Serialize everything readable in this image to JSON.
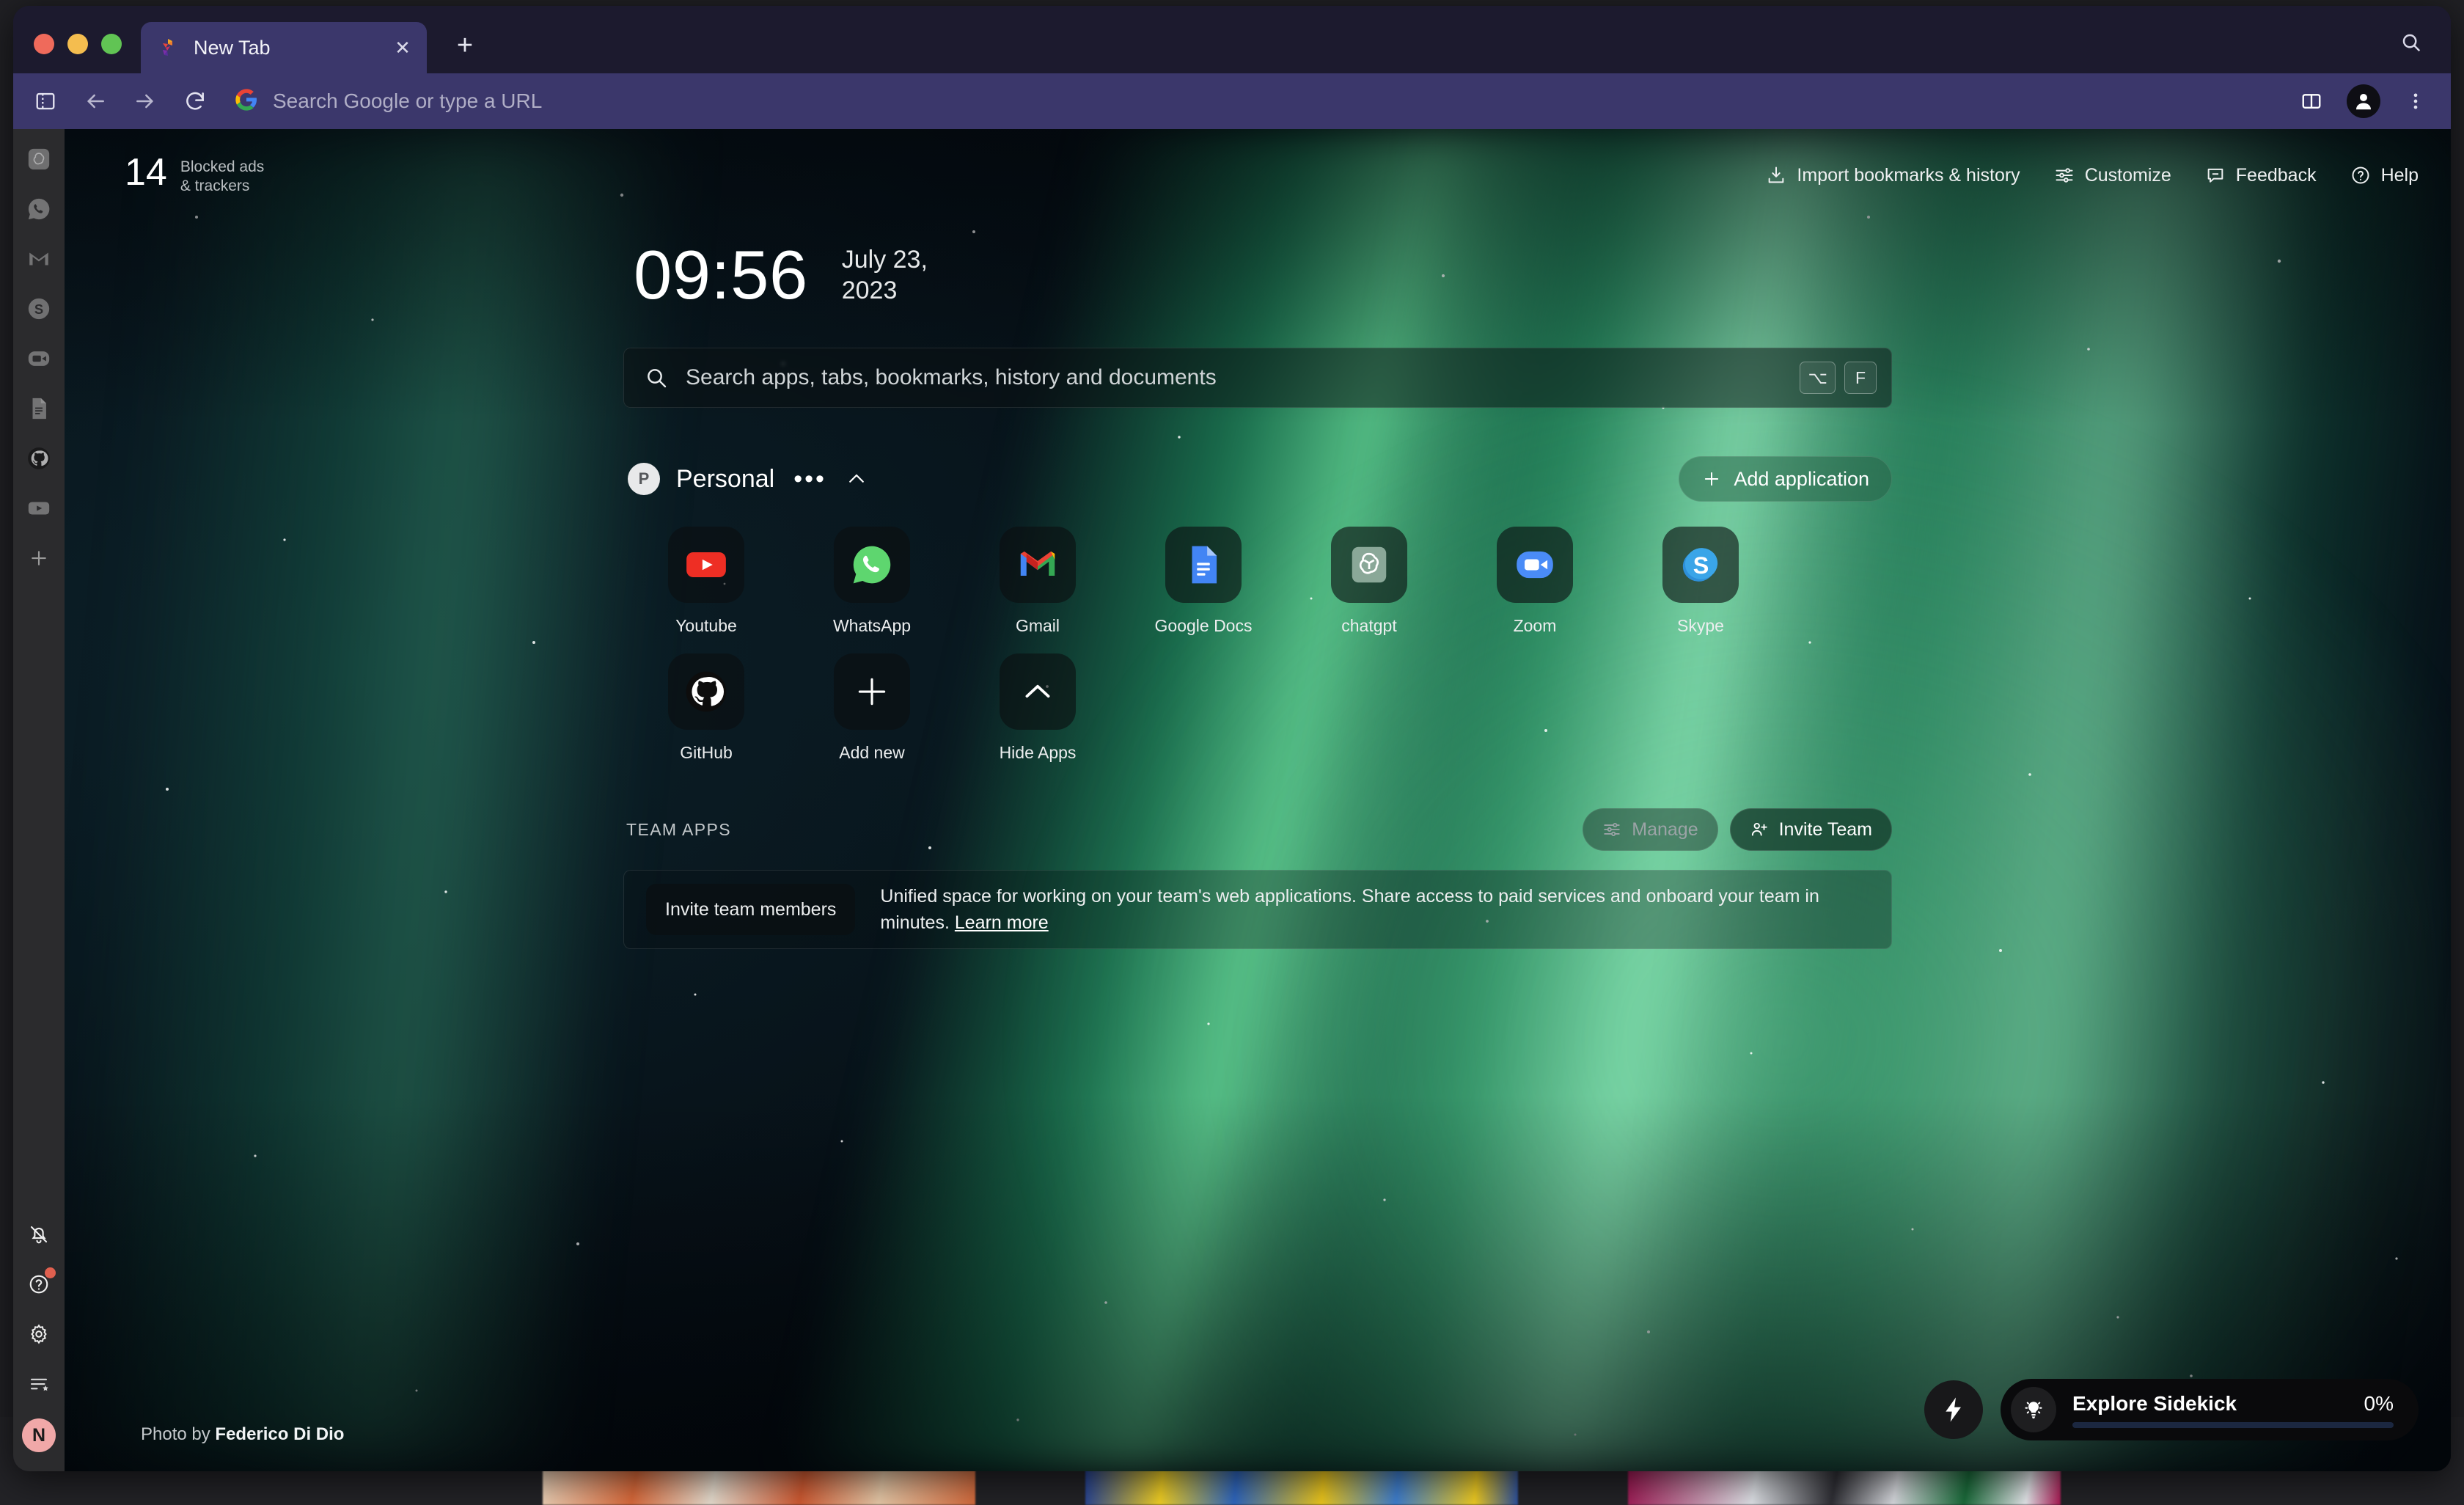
{
  "browser": {
    "tab": {
      "title": "New Tab",
      "favicon": "sidekick-logo-icon",
      "close_label": "✕"
    },
    "new_tab_label": "+",
    "omnibox": {
      "placeholder": "Search Google or type a URL",
      "engine_icon": "google-icon"
    },
    "toolbar": {
      "sidebar_toggle_icon": "sidebar-toggle-icon",
      "back_icon": "arrow-left-icon",
      "forward_icon": "arrow-right-icon",
      "reload_icon": "reload-icon",
      "split_view_icon": "split-view-icon",
      "profile_icon": "profile-avatar-icon",
      "menu_icon": "three-dot-menu-icon",
      "window_search_icon": "search-icon"
    },
    "traffic_lights": [
      "close",
      "minimize",
      "maximize"
    ],
    "accent": "#3b376b",
    "tabstrip_bg": "#1c1a2e"
  },
  "sidebar": {
    "apps": [
      {
        "name": "chatgpt",
        "icon": "chatgpt-icon"
      },
      {
        "name": "WhatsApp",
        "icon": "whatsapp-icon"
      },
      {
        "name": "Gmail",
        "icon": "gmail-icon"
      },
      {
        "name": "Skype",
        "icon": "skype-icon"
      },
      {
        "name": "Zoom",
        "icon": "zoom-icon"
      },
      {
        "name": "Google Docs",
        "icon": "google-docs-icon"
      },
      {
        "name": "GitHub",
        "icon": "github-icon"
      },
      {
        "name": "Youtube",
        "icon": "youtube-icon"
      }
    ],
    "add_icon": "plus-icon",
    "bottom": [
      {
        "name": "notifications-muted",
        "icon": "bell-off-icon"
      },
      {
        "name": "help",
        "icon": "question-circle-icon",
        "badge": true
      },
      {
        "name": "settings",
        "icon": "gear-icon"
      },
      {
        "name": "reading-list",
        "icon": "list-star-icon"
      }
    ],
    "user_initial": "N",
    "user_avatar_color": "#f0a8a8"
  },
  "newtab": {
    "blocked": {
      "count": "14",
      "label_line1": "Blocked ads",
      "label_line2": "& trackers"
    },
    "links": [
      {
        "label": "Import bookmarks & history",
        "icon": "import-icon"
      },
      {
        "label": "Customize",
        "icon": "sliders-icon"
      },
      {
        "label": "Feedback",
        "icon": "feedback-icon"
      },
      {
        "label": "Help",
        "icon": "help-circle-icon"
      }
    ],
    "clock": "09:56",
    "date_line1": "July 23,",
    "date_line2": "2023",
    "search": {
      "placeholder": "Search apps, tabs, bookmarks, history and documents",
      "icon": "search-icon",
      "shortcut_keys": [
        "⌥",
        "F"
      ]
    },
    "workspace": {
      "initial": "P",
      "name": "Personal",
      "more_label": "•••",
      "collapse_icon": "chevron-up-icon",
      "add_application_label": "Add application",
      "add_application_icon": "plus-icon"
    },
    "apps": [
      {
        "label": "Youtube",
        "icon": "youtube-icon"
      },
      {
        "label": "WhatsApp",
        "icon": "whatsapp-icon"
      },
      {
        "label": "Gmail",
        "icon": "gmail-icon"
      },
      {
        "label": "Google Docs",
        "icon": "google-docs-icon"
      },
      {
        "label": "chatgpt",
        "icon": "chatgpt-icon"
      },
      {
        "label": "Zoom",
        "icon": "zoom-icon"
      },
      {
        "label": "Skype",
        "icon": "skype-icon"
      },
      {
        "label": "GitHub",
        "icon": "github-icon"
      },
      {
        "label": "Add new",
        "icon": "plus-icon"
      },
      {
        "label": "Hide Apps",
        "icon": "chevron-up-icon"
      }
    ],
    "team": {
      "title": "TEAM APPS",
      "manage_label": "Manage",
      "manage_icon": "sliders-icon",
      "invite_label": "Invite Team",
      "invite_icon": "person-add-icon",
      "banner_button": "Invite team members",
      "banner_text": "Unified space for working on your team's web applications. Share access to paid services and onboard your team in minutes. ",
      "banner_link": "Learn more"
    },
    "credit_prefix": "Photo by ",
    "credit_author": "Federico Di Dio",
    "sidekick": {
      "bolt_icon": "lightning-bolt-icon",
      "bulb_icon": "lightbulb-icon",
      "title": "Explore Sidekick",
      "percent": "0%",
      "progress": 0,
      "bar_color": "#4f8cff"
    }
  }
}
